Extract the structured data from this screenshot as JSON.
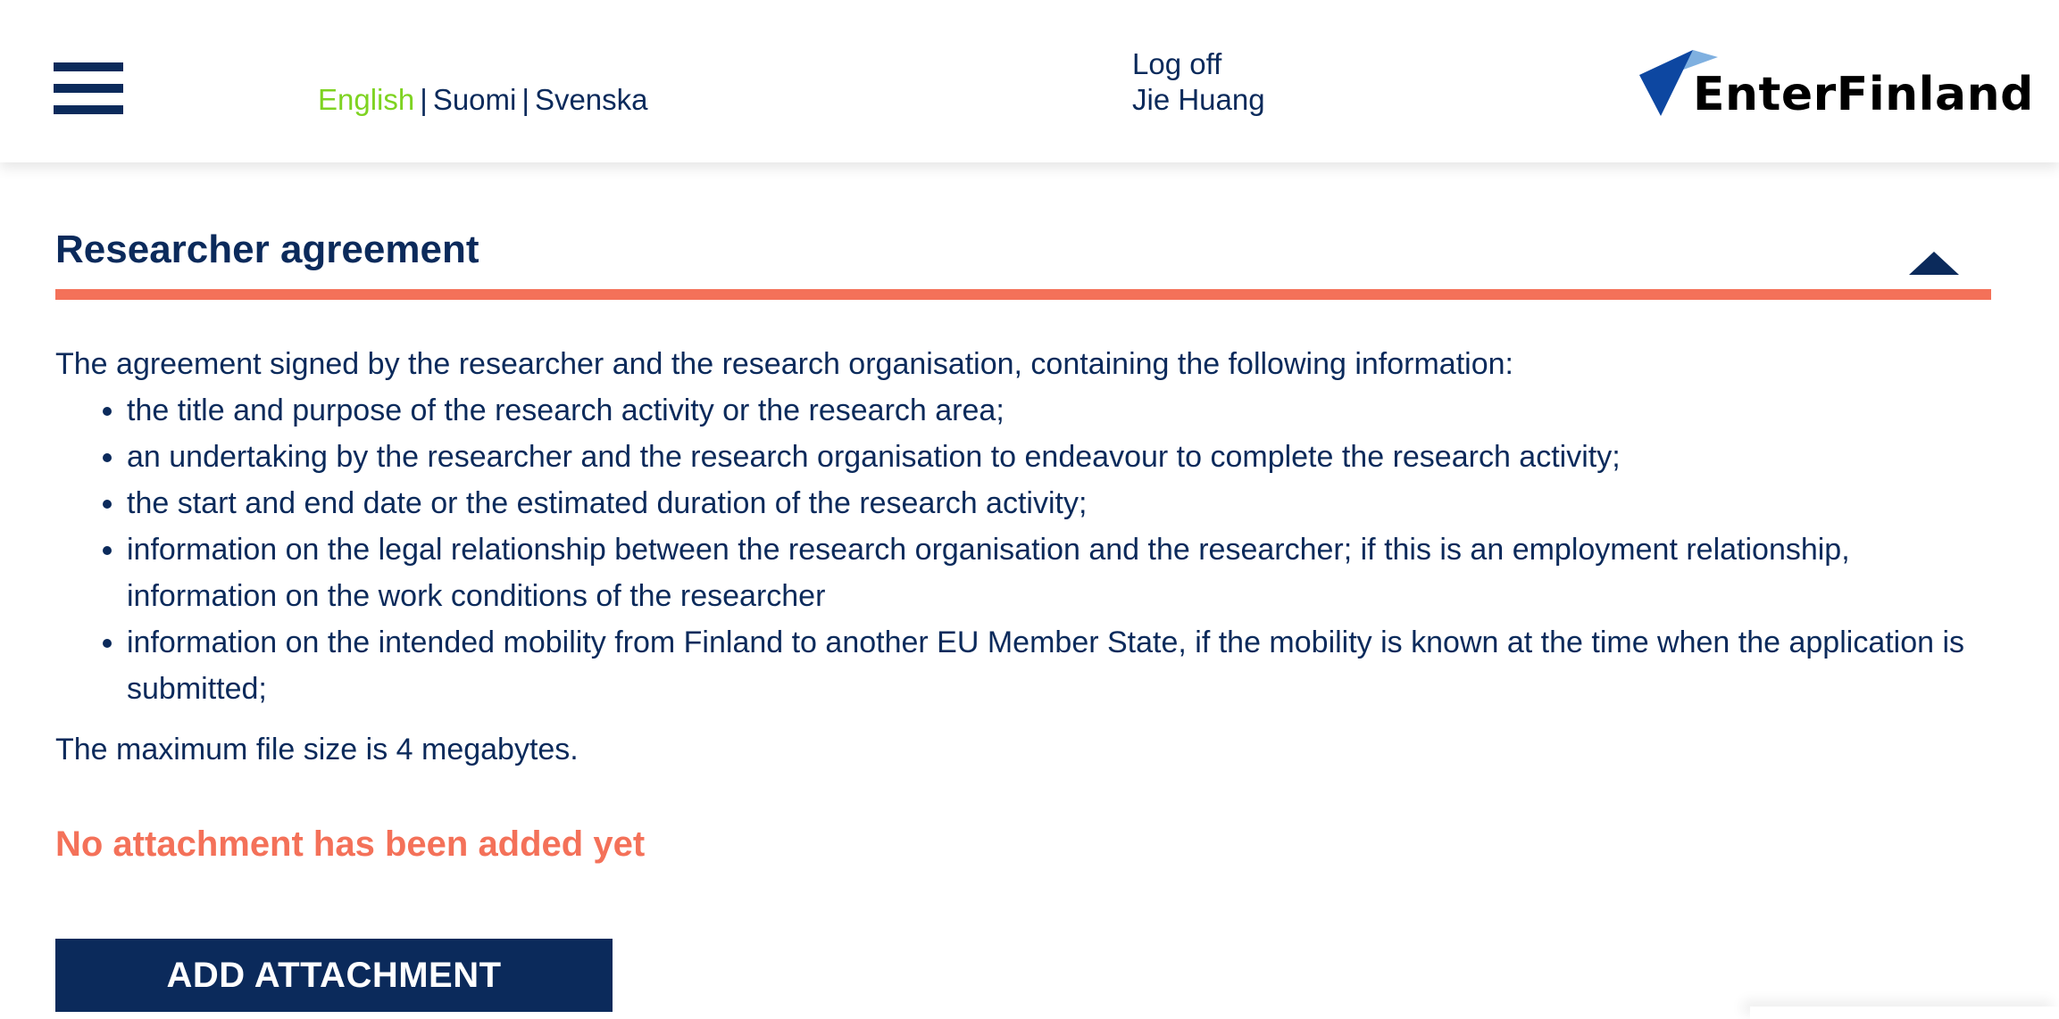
{
  "header": {
    "languages": [
      {
        "label": "English",
        "active": true
      },
      {
        "label": "Suomi",
        "active": false
      },
      {
        "label": "Svenska",
        "active": false
      }
    ],
    "separator": "|",
    "logoff_label": "Log off",
    "user_name": "Jie Huang",
    "logo_text": "EnterFinland",
    "menu_icon": "hamburger-menu-icon"
  },
  "section": {
    "title": "Researcher agreement",
    "collapse_icon": "triangle-up-icon",
    "intro": "The agreement signed by the researcher and the research organisation, containing the following information:",
    "bullets": [
      "the title and purpose of the research activity or the research area;",
      "an undertaking by the researcher and the research organisation to endeavour to complete the research activity;",
      "the start and end date or the estimated duration of the research activity;",
      "information on the legal relationship between the research organisation and the researcher; if this is an employment relationship, information on the work conditions of the researcher",
      "information on the intended mobility from Finland to another EU Member State, if the mobility is known at the time when the application is submitted;"
    ],
    "max_size_text": "The maximum file size is 4 megabytes.",
    "no_attachment_text": "No attachment has been added yet",
    "add_button_label": "ADD ATTACHMENT"
  },
  "colors": {
    "primary": "#0b2a5b",
    "accent": "#f47159",
    "active_language": "#7ed321"
  }
}
